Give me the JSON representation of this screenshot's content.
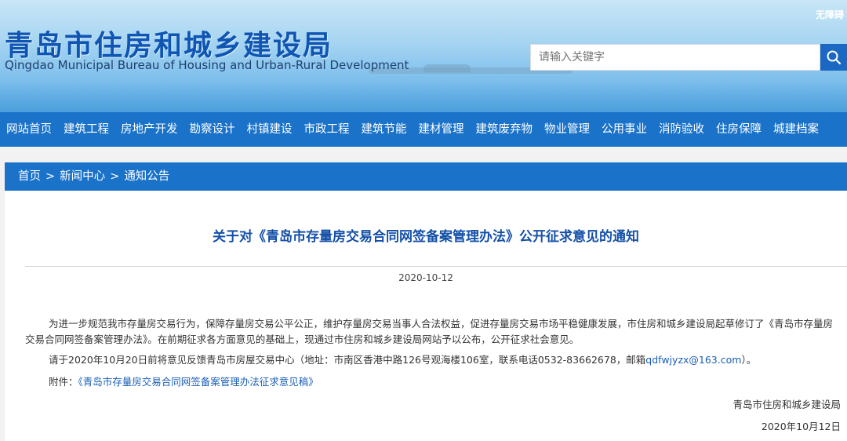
{
  "header": {
    "accessibility_label": "无障碍",
    "title": "青岛市住房和城乡建设局",
    "subtitle": "Qingdao Municipal Bureau of Housing and Urban-Rural Development",
    "search_placeholder": "请输入关键字",
    "search_icon": "search-icon"
  },
  "nav": {
    "items": [
      {
        "label": "网站首页"
      },
      {
        "label": "建筑工程"
      },
      {
        "label": "房地产开发"
      },
      {
        "label": "勘察设计"
      },
      {
        "label": "村镇建设"
      },
      {
        "label": "市政工程"
      },
      {
        "label": "建筑节能"
      },
      {
        "label": "建材管理"
      },
      {
        "label": "建筑废弃物"
      },
      {
        "label": "物业管理"
      },
      {
        "label": "公用事业"
      },
      {
        "label": "消防验收"
      },
      {
        "label": "住房保障"
      },
      {
        "label": "城建档案"
      }
    ]
  },
  "breadcrumb": {
    "home": "首页",
    "sep": ">",
    "section": "新闻中心",
    "current": "通知公告"
  },
  "article": {
    "title": "关于对《青岛市存量房交易合同网签备案管理办法》公开征求意见的通知",
    "date": "2020-10-12",
    "p1": "为进一步规范我市存量房交易行为，保障存量房交易公平公正，维护存量房交易当事人合法权益，促进存量房交易市场平稳健康发展，市住房和城乡建设局起草修订了《青岛市存量房交易合同网签备案管理办法》。在前期征求各方面意见的基础上，现通过市住房和城乡建设局网站予以公布，公开征求社会意见。",
    "p2_text": "请于2020年10月20日前将意见反馈青岛市房屋交易中心（地址：市南区香港中路126号观海楼106室，联系电话0532-83662678，邮箱",
    "p2_email": "qdfwjyzx@163.com",
    "p2_end": "）。",
    "attachment_label": "附件：",
    "attachment_link": "《青岛市存量房交易合同网签备案管理办法征求意见稿》",
    "signature": "青岛市住房和城乡建设局",
    "sign_date": "2020年10月12日"
  },
  "colors": {
    "nav_bg": "#1a72c9",
    "title_blue": "#1450a8",
    "link_blue": "#1a5fb4"
  }
}
